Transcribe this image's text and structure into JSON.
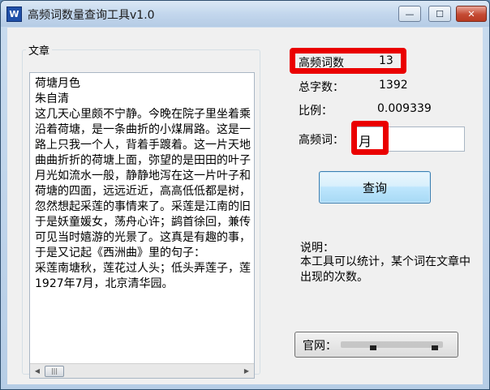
{
  "window": {
    "icon_letter": "W",
    "title": "高频词数量查询工具v1.0",
    "controls": {
      "minimize": "—",
      "maximize": "☐",
      "close": "✕"
    }
  },
  "article": {
    "group_label": "文章",
    "lines": [
      "荷塘月色",
      "朱自清",
      "这几天心里颇不宁静。今晚在院子里坐着乘凉",
      "沿着荷塘，是一条曲折的小煤屑路。这是一条幽",
      "路上只我一个人，背着手踱着。这一片天地好像",
      "曲曲折折的荷塘上面，弥望的是田田的叶子。叶",
      "月光如流水一般，静静地泻在这一片叶子和花上",
      "荷塘的四面，远远近近，高高低低都是树，而杨",
      "忽然想起采莲的事情来了。采莲是江南的旧俗，",
      "于是妖童媛女，荡舟心许；鹢首徐回，兼传羽杯",
      "可见当时嬉游的光景了。这真是有趣的事，可惜",
      "于是又记起《西洲曲》里的句子：",
      "采莲南塘秋，莲花过人头；低头弄莲子，莲子清",
      "1927年7月，北京清华园。"
    ]
  },
  "stats": {
    "high_freq_label": "高频词数",
    "high_freq_value": "13",
    "total_label": "总字数：",
    "total_value": "1392",
    "ratio_label": "比例：",
    "ratio_value": "0.009339",
    "word_label": "高频词：",
    "word_value": "月"
  },
  "query_button": "查询",
  "note": {
    "title": "说明：",
    "body": "本工具可以统计，某个词在文章中出现的次数。"
  },
  "site": {
    "label": "官网："
  },
  "colors": {
    "highlight": "#ea0000",
    "button_border": "#3c7fb1"
  }
}
